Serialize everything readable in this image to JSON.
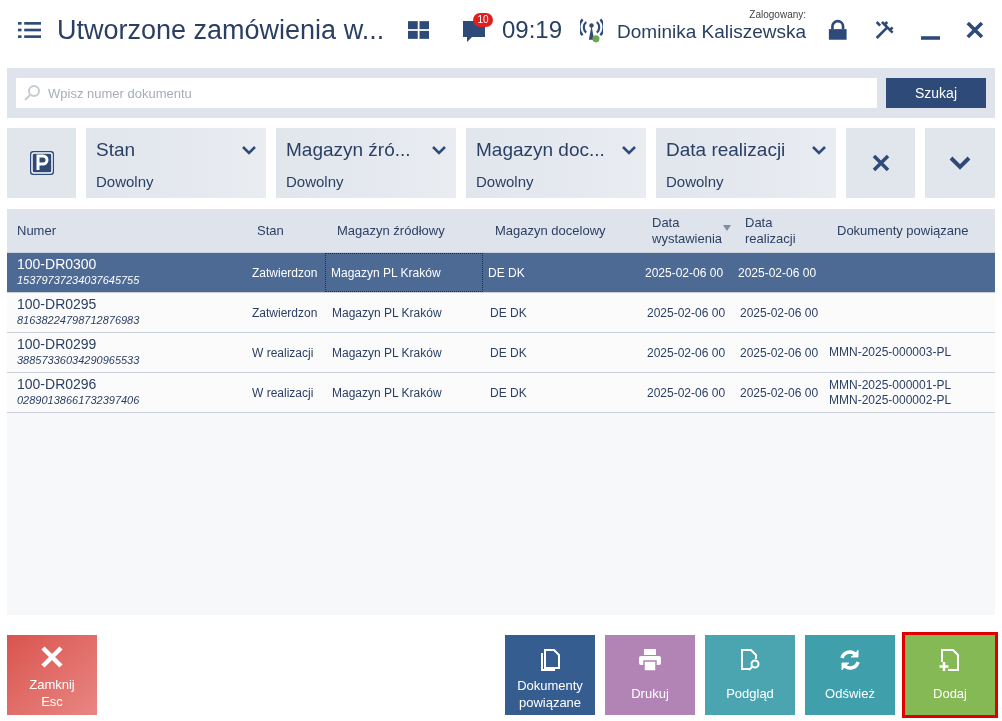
{
  "header": {
    "title": "Utworzone zamówienia w...",
    "notifications": "10",
    "time": "09:19",
    "logged_label": "Zalogowany:",
    "user": "Dominika Kaliszewska"
  },
  "search": {
    "placeholder": "Wpisz numer dokumentu",
    "button": "Szukaj"
  },
  "filters": [
    {
      "label": "Stan",
      "value": "Dowolny"
    },
    {
      "label": "Magazyn źró...",
      "value": "Dowolny"
    },
    {
      "label": "Magazyn doc...",
      "value": "Dowolny"
    },
    {
      "label": "Data realizacji",
      "value": "Dowolny"
    }
  ],
  "table": {
    "columns": [
      "Numer",
      "Stan",
      "Magazyn źródłowy",
      "Magazyn docelowy",
      "Data wystawienia",
      "Data realizacji",
      "Dokumenty powiązane"
    ],
    "rows": [
      {
        "selected": true,
        "code": "15379737234037645755",
        "cells": [
          "100-DR0300",
          "Zatwierdzon",
          "Magazyn PL Kraków",
          "DE DK",
          "2025-02-06 00",
          "2025-02-06 00",
          ""
        ]
      },
      {
        "selected": false,
        "code": "81638224798712876983",
        "cells": [
          "100-DR0295",
          "Zatwierdzon",
          "Magazyn PL Kraków",
          "DE DK",
          "2025-02-06 00",
          "2025-02-06 00",
          ""
        ]
      },
      {
        "selected": false,
        "code": "38857336034290965533",
        "cells": [
          "100-DR0299",
          "W realizacji",
          "Magazyn PL Kraków",
          "DE DK",
          "2025-02-06 00",
          "2025-02-06 00",
          "MMN-2025-000003-PL"
        ]
      },
      {
        "selected": false,
        "code": "02890138661732397406",
        "cells": [
          "100-DR0296",
          "W realizacji",
          "Magazyn PL Kraków",
          "DE DK",
          "2025-02-06 00",
          "2025-02-06 00",
          "MMN-2025-000001-PL\nMMN-2025-000002-PL"
        ]
      }
    ]
  },
  "close_button": {
    "label": "Zamknij",
    "shortcut": "Esc"
  },
  "actions": [
    {
      "label": "Dokumenty powiązane",
      "color": "#365d8f",
      "highlighted": false
    },
    {
      "label": "Drukuj",
      "color": "#b283b5",
      "highlighted": false
    },
    {
      "label": "Podgląd",
      "color": "#4aa5b0",
      "highlighted": false
    },
    {
      "label": "Odśwież",
      "color": "#3f9fab",
      "highlighted": false
    },
    {
      "label": "Dodaj",
      "color": "#85b955",
      "highlighted": true
    }
  ]
}
